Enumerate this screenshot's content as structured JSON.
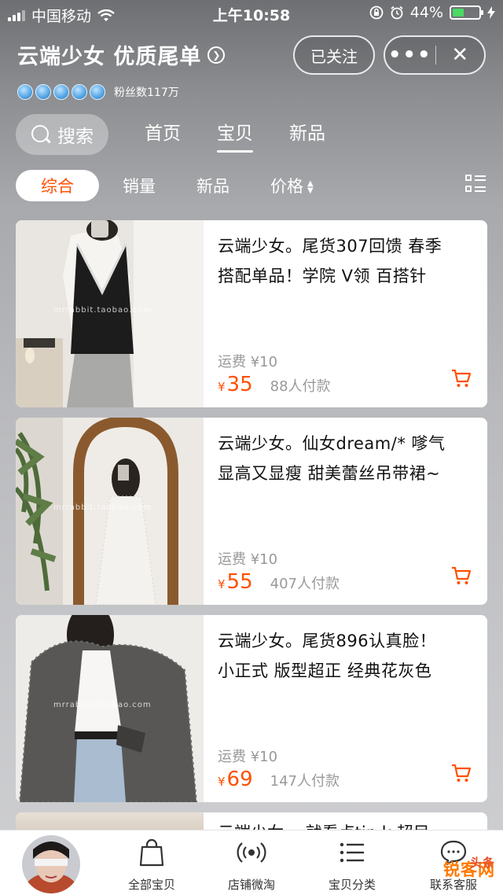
{
  "status_bar": {
    "carrier": "中国移动",
    "time": "上午10:58",
    "battery": "44%",
    "battery_level": 0.44
  },
  "shop": {
    "name": "云端少女 优质尾单",
    "rating_crowns": 5,
    "fans": "粉丝数117万",
    "follow_label": "已关注",
    "more_label": "•••",
    "close_label": "✕"
  },
  "nav": {
    "search_label": "搜索",
    "tabs": [
      {
        "label": "首页",
        "active": false
      },
      {
        "label": "宝贝",
        "active": true
      },
      {
        "label": "新品",
        "active": false
      }
    ]
  },
  "sort": {
    "items": [
      "综合",
      "销量",
      "新品",
      "价格"
    ],
    "active": "综合"
  },
  "products": [
    {
      "title_line1": "云端少女。尾货307回馈 春季",
      "title_line2": "搭配单品！学院 V领  百搭针",
      "shipping": "运费 ¥10",
      "currency": "¥",
      "price": "35",
      "sold": "88人付款",
      "watermark": "mrrabbit.taobao.com"
    },
    {
      "title_line1": "云端少女。仙女dream/* 嗲气",
      "title_line2": "显高又显瘦 甜美蕾丝吊带裙~",
      "shipping": "运费 ¥10",
      "currency": "¥",
      "price": "55",
      "sold": "407人付款",
      "watermark": "mrrabbit.taobao.com"
    },
    {
      "title_line1": "云端少女。尾货896认真脸！",
      "title_line2": "小正式  版型超正  经典花灰色",
      "shipping": "运费 ¥10",
      "currency": "¥",
      "price": "69",
      "sold": "147人付款",
      "watermark": "mrrabbit.taobao.com"
    }
  ],
  "peek_title": "云端少女。 就看点tin k 超目",
  "tabbar": {
    "items": [
      {
        "label": "全部宝贝",
        "icon": "shopping-bag-icon"
      },
      {
        "label": "店铺微淘",
        "icon": "broadcast-icon"
      },
      {
        "label": "宝贝分类",
        "icon": "list-icon"
      },
      {
        "label": "联系客服",
        "icon": "chat-icon"
      }
    ]
  },
  "watermark_logo": {
    "text": "锐客网",
    "sub": "头条"
  },
  "colors": {
    "accent": "#ff5000",
    "status_green": "#4cd964",
    "crown_blue": "#5aa9e6"
  }
}
